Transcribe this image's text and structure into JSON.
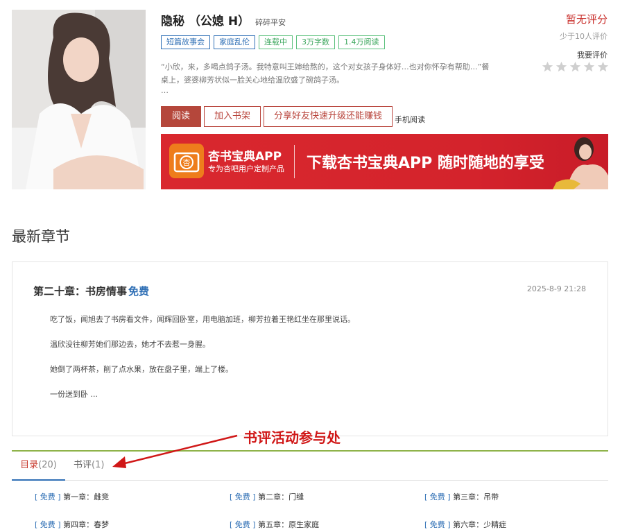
{
  "book": {
    "title": "隐秘 （公媳 H）",
    "author": "碎碎平安",
    "tags": [
      {
        "label": "短篇故事会",
        "style": "blue"
      },
      {
        "label": "家庭乱伦",
        "style": "blue"
      },
      {
        "label": "连载中",
        "style": "green"
      },
      {
        "label": "3万字数",
        "style": "green"
      },
      {
        "label": "1.4万阅读",
        "style": "green"
      }
    ],
    "intro_line1": "“小欣，来，多喝点鸽子汤。我特意叫王婶给熬的，这个对女孩子身体好…也对你怀孕有帮助…”餐",
    "intro_line2": "桌上，婆婆柳芳状似一脸关心地给温欣盛了碗鸽子汤。",
    "intro_more": "…"
  },
  "rating": {
    "status": "暂无评分",
    "count_text": "少于10人评价",
    "rate_action": "我要评价",
    "stars": 0,
    "max_stars": 5
  },
  "actions": {
    "read_label": "阅读",
    "add_shelf_label": "加入书架",
    "share_label": "分享好友快速升级还能赚钱",
    "mobile_label": "手机阅读"
  },
  "banner": {
    "app_name": "杏书宝典APP",
    "subtitle": "专为杏吧用户定制产品",
    "slogan": "下载杏书宝典APP 随时随地的享受",
    "logo_char": "杏"
  },
  "latest": {
    "section_title": "最新章节",
    "chapter_title": "第二十章：书房情事",
    "free_label": "免费",
    "date": "2025-8-9 21:28",
    "paragraphs": [
      "吃了饭，闻旭去了书房看文件，闻辉回卧室，用电脑加班，柳芳拉着王艳红坐在那里说话。",
      "温欣没往柳芳她们那边去，她才不去惹一身腥。",
      "她倒了两杯茶，削了点水果，放在盘子里，端上了楼。",
      "一份送到卧 ..."
    ]
  },
  "annotation": {
    "text": "书评活动参与处"
  },
  "tabs": [
    {
      "label": "目录",
      "count": "(20)"
    },
    {
      "label": "书评",
      "count": "(1)"
    }
  ],
  "chapters": [
    {
      "free": "[ 免费 ]",
      "title": "第一章：雌竞"
    },
    {
      "free": "[ 免费 ]",
      "title": "第二章：门缝"
    },
    {
      "free": "[ 免费 ]",
      "title": "第三章：吊带"
    },
    {
      "free": "[ 免费 ]",
      "title": "第四章：春梦"
    },
    {
      "free": "[ 免费 ]",
      "title": "第五章：原生家庭"
    },
    {
      "free": "[ 免费 ]",
      "title": "第六章：少精症"
    }
  ],
  "colors": {
    "accent_red": "#c9302c",
    "button_red": "#b5473b",
    "link_blue": "#2f6fb5",
    "tag_green": "#3ba65c",
    "tab_green": "#8fb34a",
    "banner_red": "#d9282e"
  }
}
